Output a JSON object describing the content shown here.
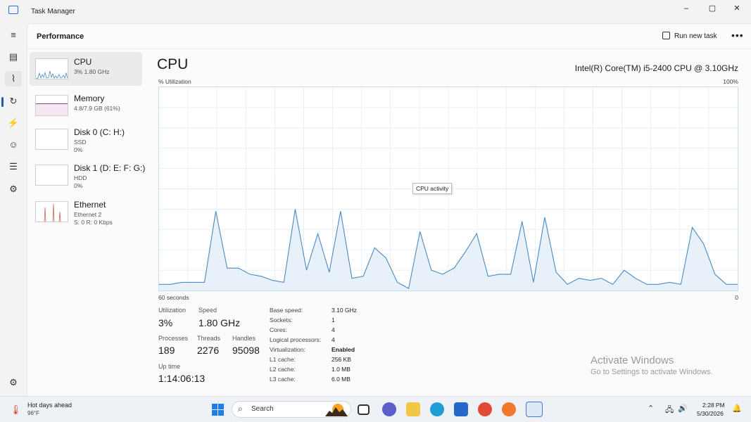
{
  "window": {
    "title": "Task Manager",
    "controls": {
      "minimize": "–",
      "maximize": "▢",
      "close": "✕"
    }
  },
  "rail": {
    "items": [
      {
        "icon": "hamburger-menu-icon",
        "glyph": "≡"
      },
      {
        "icon": "processes-icon",
        "glyph": "▤"
      },
      {
        "icon": "performance-icon",
        "glyph": "⌇",
        "active": true
      },
      {
        "icon": "app-history-icon",
        "glyph": "↻"
      },
      {
        "icon": "startup-apps-icon",
        "glyph": "⚡"
      },
      {
        "icon": "users-icon",
        "glyph": "☺"
      },
      {
        "icon": "details-icon",
        "glyph": "☰"
      },
      {
        "icon": "services-icon",
        "glyph": "⚙"
      },
      {
        "icon": "settings-icon",
        "glyph": "⚙"
      }
    ]
  },
  "header": {
    "title": "Performance",
    "run_new_task": "Run new task",
    "more": "•••"
  },
  "devices": [
    {
      "name": "CPU",
      "line1": "3%  1.80 GHz",
      "line2": "",
      "line3": "",
      "selected": true
    },
    {
      "name": "Memory",
      "line1": "4.8/7.9 GB (61%)",
      "line2": "",
      "line3": ""
    },
    {
      "name": "Disk 0 (C: H:)",
      "line1": "SSD",
      "line2": "0%",
      "line3": ""
    },
    {
      "name": "Disk 1 (D: E: F: G:)",
      "line1": "HDD",
      "line2": "0%",
      "line3": ""
    },
    {
      "name": "Ethernet",
      "line1": "Ethernet 2",
      "line2": "S: 0  R: 0 Kbps",
      "line3": ""
    }
  ],
  "detail": {
    "title": "CPU",
    "model": "Intel(R) Core(TM) i5-2400 CPU @ 3.10GHz",
    "y_axis_label": "% Utilization",
    "y_axis_max": "100%",
    "x_axis_left": "60 seconds",
    "x_axis_right": "0",
    "tooltip": "CPU activity",
    "graph_color": "#4a8ac2",
    "graph_fill": "#e8f1fa",
    "utilization": [
      3,
      3,
      4,
      4,
      4,
      39,
      11,
      11,
      8,
      7,
      5,
      4,
      40,
      10,
      28,
      9,
      39,
      6,
      7,
      21,
      16,
      4,
      1,
      29,
      10,
      8,
      11,
      19,
      28,
      7,
      8,
      8,
      34,
      4,
      36,
      9,
      3,
      6,
      5,
      6,
      3,
      10,
      6,
      3,
      3,
      4,
      3,
      31,
      23,
      8,
      3,
      3
    ]
  },
  "stats": {
    "utilization": {
      "label": "Utilization",
      "value": "3%"
    },
    "speed": {
      "label": "Speed",
      "value": "1.80 GHz"
    },
    "processes": {
      "label": "Processes",
      "value": "189"
    },
    "threads": {
      "label": "Threads",
      "value": "2276"
    },
    "handles": {
      "label": "Handles",
      "value": "95098"
    },
    "uptime": {
      "label": "Up time",
      "value": "1:14:06:13"
    }
  },
  "specs": [
    {
      "key": "Base speed:",
      "value": "3.10 GHz",
      "bold": false
    },
    {
      "key": "Sockets:",
      "value": "1",
      "bold": false
    },
    {
      "key": "Cores:",
      "value": "4",
      "bold": false
    },
    {
      "key": "Logical processors:",
      "value": "4",
      "bold": false
    },
    {
      "key": "Virtualization:",
      "value": "Enabled",
      "bold": true
    },
    {
      "key": "L1 cache:",
      "value": "256 KB",
      "bold": false
    },
    {
      "key": "L2 cache:",
      "value": "1.0 MB",
      "bold": false
    },
    {
      "key": "L3 cache:",
      "value": "6.0 MB",
      "bold": false
    }
  ],
  "watermark": {
    "title": "Activate Windows",
    "subtitle": "Go to Settings to activate Windows."
  },
  "taskbar": {
    "weather_title": "Hot days ahead",
    "weather_temp": "96°F",
    "search_placeholder": "Search",
    "apps": [
      {
        "name": "file-explorer-taskbar-icon",
        "color": "#f2c744"
      },
      {
        "name": "edge-taskbar-icon",
        "color": "#1f9bd7"
      },
      {
        "name": "store-taskbar-icon",
        "color": "#2568c9"
      },
      {
        "name": "chrome-taskbar-icon",
        "color": "#e04a36"
      },
      {
        "name": "firefox-taskbar-icon",
        "color": "#f0792b"
      },
      {
        "name": "task-manager-taskbar-icon",
        "color": "#3a7bd5"
      }
    ],
    "time": "2:28 PM",
    "date": "5/30/2026"
  }
}
